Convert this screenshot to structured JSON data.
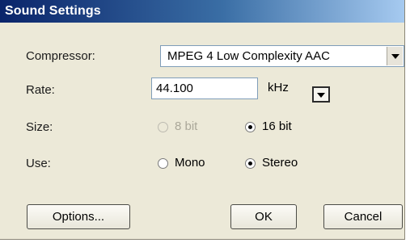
{
  "window": {
    "title": "Sound Settings"
  },
  "compressor": {
    "label": "Compressor:",
    "value": "MPEG 4 Low Complexity AAC"
  },
  "rate": {
    "label": "Rate:",
    "value": "44.100",
    "unit": "kHz"
  },
  "size": {
    "label": "Size:",
    "options": [
      {
        "label": "8 bit",
        "selected": false,
        "enabled": false
      },
      {
        "label": "16 bit",
        "selected": true,
        "enabled": true
      }
    ]
  },
  "use": {
    "label": "Use:",
    "options": [
      {
        "label": "Mono",
        "selected": false,
        "enabled": true
      },
      {
        "label": "Stereo",
        "selected": true,
        "enabled": true
      }
    ]
  },
  "buttons": {
    "options": "Options...",
    "ok": "OK",
    "cancel": "Cancel"
  },
  "icons": {
    "dropdown": "chevron-down-icon",
    "unit_menu": "triangle-down-icon"
  },
  "colors": {
    "titlebar_start": "#0a246a",
    "titlebar_end": "#a6caf0",
    "dialog_bg": "#ece9d8"
  }
}
